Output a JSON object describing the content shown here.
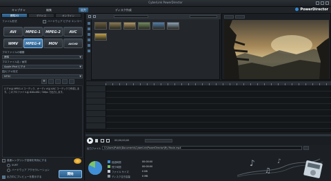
{
  "window": {
    "title": "CyberLink PowerDirector",
    "brand": "PowerDirector"
  },
  "top_tabs": [
    "キャプチャ",
    "編集",
    "出力",
    "ディスク作成"
  ],
  "left_panel": {
    "subtabs": [
      "標準2D",
      "デバイス",
      "オンライン"
    ],
    "format_section_label": "ファイル形式",
    "format_buttons": [
      "AVI",
      "MPEG-1",
      "MPEG-2",
      "AVC",
      "WMV",
      "MPEG-4",
      "MOV",
      "AVCHD"
    ],
    "selected_format": "MPEG-4",
    "hw_checkbox_label": "ハードウェア ビデオ エンコーダー",
    "profile_type_label": "プロファイルの種類",
    "profile_type_value": "標準",
    "profile_name_label": "プロファイル名 / 画質",
    "profile_name_value": "Apple iPod ビデオ",
    "country_label": "国/ビデオ形式",
    "country_value": "NTSC",
    "description": "ビデオは MPEG-4 コーデック、オーディオは AAC コーデックで作成します。このプロファイルは 640x480 / 30fps で出力します。",
    "option_fast_render": "高速レンダリング技術を有効にする",
    "option_sw": "SVRT",
    "option_hw_accel": "ハードウェア アクセラレーション",
    "option_preview": "出力中にプレビューを表示する",
    "produce_label": "開始"
  },
  "library": {
    "thumbnails": [
      "clip-01",
      "clip-02",
      "clip-03",
      "clip-04",
      "clip-05",
      "clip-06",
      "clip-07"
    ],
    "colors": [
      "#6a5b3a",
      "#8a7a50",
      "#b49a62",
      "#6e8b5a",
      "#4e7fb0",
      "#8aa0b8",
      "#c2a24a"
    ]
  },
  "preview": {
    "timecode": "00;00;00;00"
  },
  "progress": {
    "fraction": 0.0,
    "file_label": "出力ファイル名",
    "file_path": "C:\\Users\\Public\\Documents\\CyberLink\\PowerDirector\\My Movie.mp4"
  },
  "info": {
    "rows": [
      {
        "label": "経過時間",
        "value": "00:00:00"
      },
      {
        "label": "残り時間",
        "value": "00:00:00"
      },
      {
        "label": "ファイル サイズ",
        "value": "0 KB"
      },
      {
        "label": "ディスク空き容量",
        "value": "0 MB"
      }
    ],
    "pie": {
      "used_fraction": 0.82,
      "used_color": "#3f8fd6",
      "free_color": "#7cc36a"
    }
  },
  "colors": {
    "accent": "#3d75a4",
    "highlight": "#8ec3ef"
  }
}
